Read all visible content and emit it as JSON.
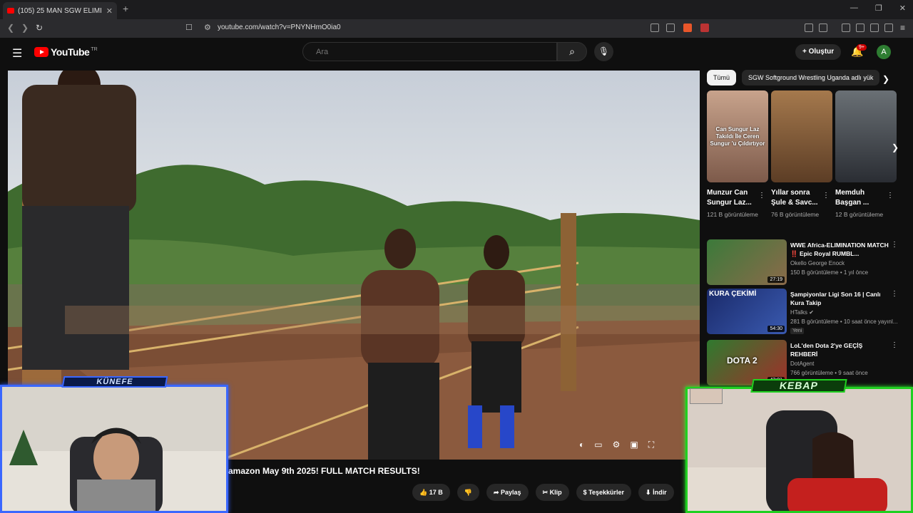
{
  "browser": {
    "tab_title": "(105) 25 MAN SGW ELIMINATIO",
    "url": "youtube.com/watch?v=PNYNHmO0ia0"
  },
  "header": {
    "logo_text": "YouTube",
    "country_code": "TR",
    "search_placeholder": "Ara",
    "create_label": "Oluştur",
    "notif_count": "9+",
    "avatar_letter": "A"
  },
  "video": {
    "title": "amazon May 9th 2025! FULL MATCH RESULTS!",
    "like_count": "17 B",
    "share_label": "Paylaş",
    "clip_label": "Klip",
    "thanks_label": "Teşekkürler",
    "download_label": "İndir"
  },
  "chips": [
    "Tümü",
    "SGW Softground Wrestling Uganda adlı yük"
  ],
  "shorts": [
    {
      "title": "Munzur Can Sungur Laz...",
      "views": "121 B görüntüleme",
      "overlay": "Can Sungur Laz Takıldı İle Ceren Sungur 'u Çıldırtıyor"
    },
    {
      "title": "Yıllar sonra Şule & Savc...",
      "views": "76 B görüntüleme"
    },
    {
      "title": "Memduh Başgan ...",
      "views": "12 B görüntüleme"
    }
  ],
  "related": [
    {
      "title": "WWE Africa-ELIMINATION MATCH ‼️ Epic Royal RUMBL...",
      "channel": "Okello George Enock",
      "meta": "150 B görüntüleme • 1 yıl önce",
      "duration": "27:19"
    },
    {
      "title": "Şampiyonlar Ligi Son 16 | Canlı Kura Takip",
      "channel": "HTalks",
      "meta": "281 B görüntüleme • 10 saat önce yayınl...",
      "duration": "54:30",
      "badge": "Yeni",
      "thumb_text": "KURA ÇEKİMİ"
    },
    {
      "title": "LoL'den Dota 2'ye GEÇİŞ REHBERİ",
      "channel": "DotAgent",
      "meta": "766 görüntüleme • 9 saat önce",
      "duration": "42:01",
      "thumb_text": "DOTA 2"
    }
  ],
  "overlays": {
    "left_cam_label": "KÜNEFE",
    "right_cam_label": "KEBAP"
  },
  "colors": {
    "yt_red": "#ff0000",
    "left_cam_border": "#3a67ff",
    "right_cam_border": "#20d020"
  }
}
